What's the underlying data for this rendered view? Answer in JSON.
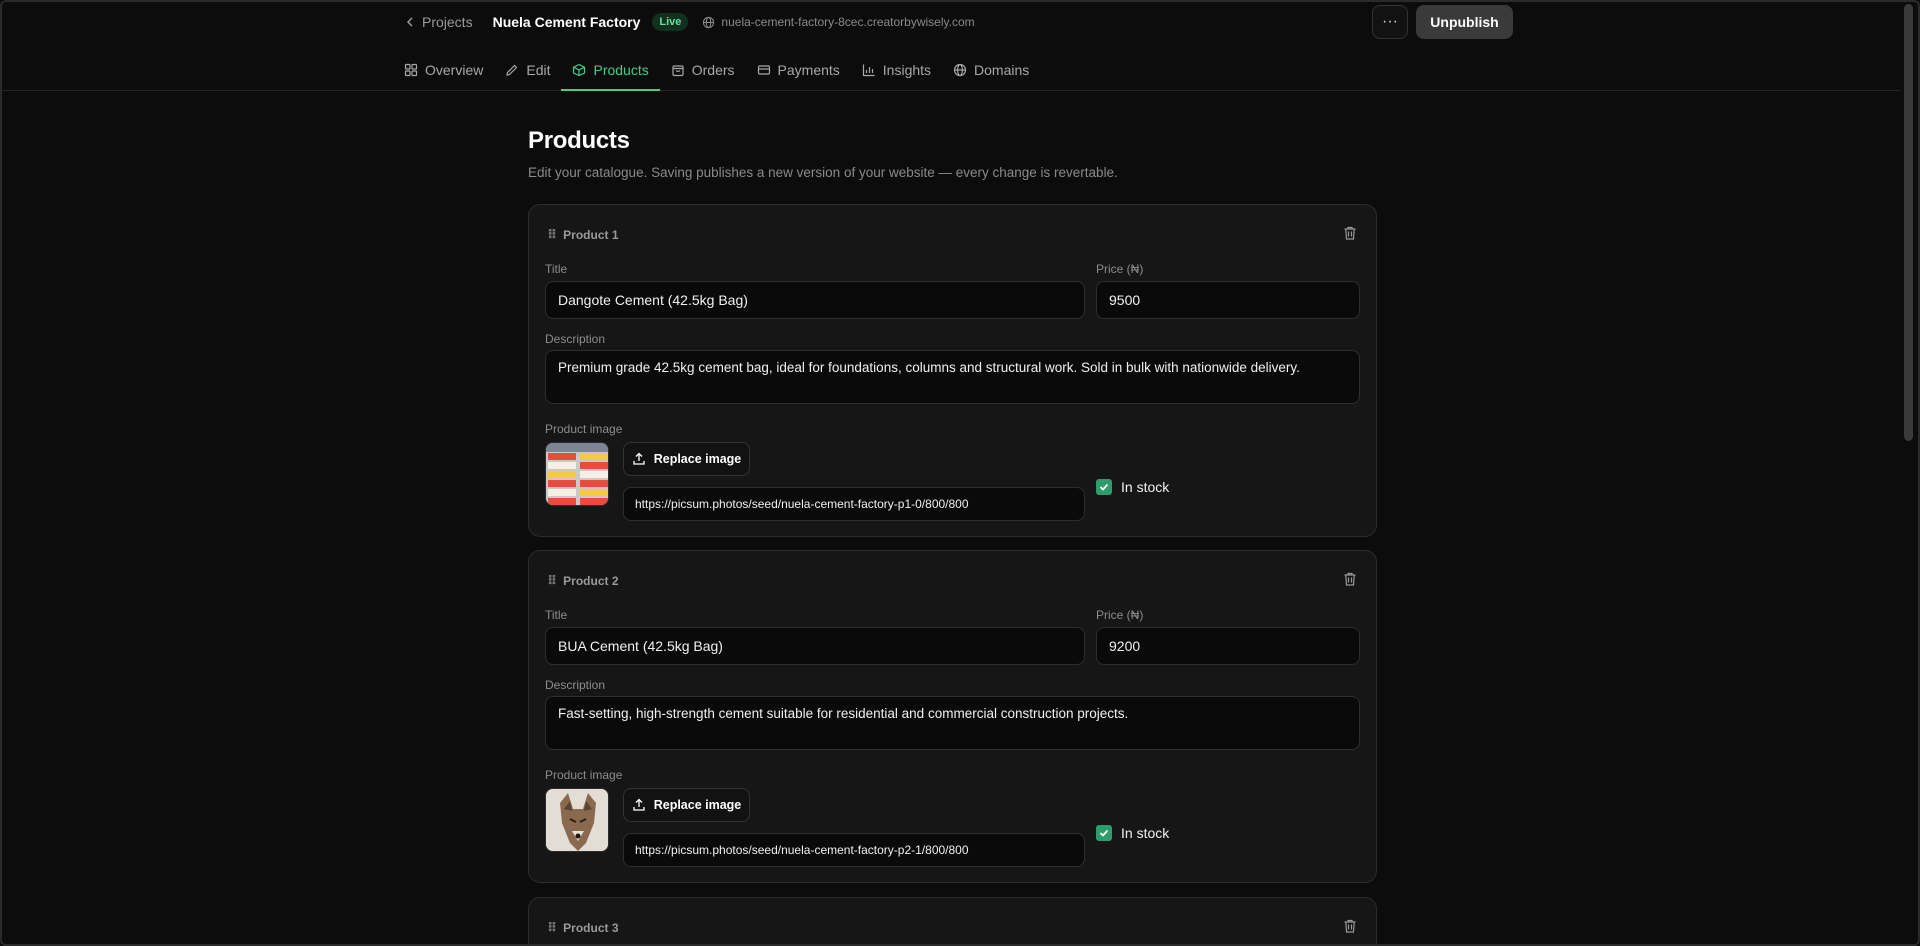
{
  "header": {
    "back_label": "Projects",
    "project_name": "Nuela Cement Factory",
    "status_badge": "Live",
    "domain": "nuela-cement-factory-8cec.creatorbywisely.com",
    "more_label": "···",
    "unpublish_label": "Unpublish"
  },
  "tabs": [
    {
      "label": "Overview",
      "icon": "grid-icon",
      "active": false
    },
    {
      "label": "Edit",
      "icon": "pencil-icon",
      "active": false
    },
    {
      "label": "Products",
      "icon": "box-icon",
      "active": true
    },
    {
      "label": "Orders",
      "icon": "bag-icon",
      "active": false
    },
    {
      "label": "Payments",
      "icon": "card-icon",
      "active": false
    },
    {
      "label": "Insights",
      "icon": "chart-icon",
      "active": false
    },
    {
      "label": "Domains",
      "icon": "globe-icon",
      "active": false
    }
  ],
  "page": {
    "title": "Products",
    "subtitle": "Edit your catalogue. Saving publishes a new version of your website — every change is revertable."
  },
  "labels": {
    "title": "Title",
    "price": "Price (₦)",
    "description": "Description",
    "image": "Product image",
    "replace": "Replace image",
    "in_stock": "In stock"
  },
  "products": [
    {
      "header": "Product 1",
      "title": "Dangote Cement (42.5kg Bag)",
      "price": "9500",
      "description": "Premium grade 42.5kg cement bag, ideal for foundations, columns and structural work. Sold in bulk with nationwide delivery.",
      "image_url": "https://picsum.photos/seed/nuela-cement-factory-p1-0/800/800",
      "in_stock": true
    },
    {
      "header": "Product 2",
      "title": "BUA Cement (42.5kg Bag)",
      "price": "9200",
      "description": "Fast-setting, high-strength cement suitable for residential and commercial construction projects.",
      "image_url": "https://picsum.photos/seed/nuela-cement-factory-p2-1/800/800",
      "in_stock": true
    },
    {
      "header": "Product 3"
    }
  ],
  "colors": {
    "accent": "#3ed08a",
    "checkbox": "#2f9d6b",
    "background": "#0c0c0c",
    "card": "#161616"
  }
}
